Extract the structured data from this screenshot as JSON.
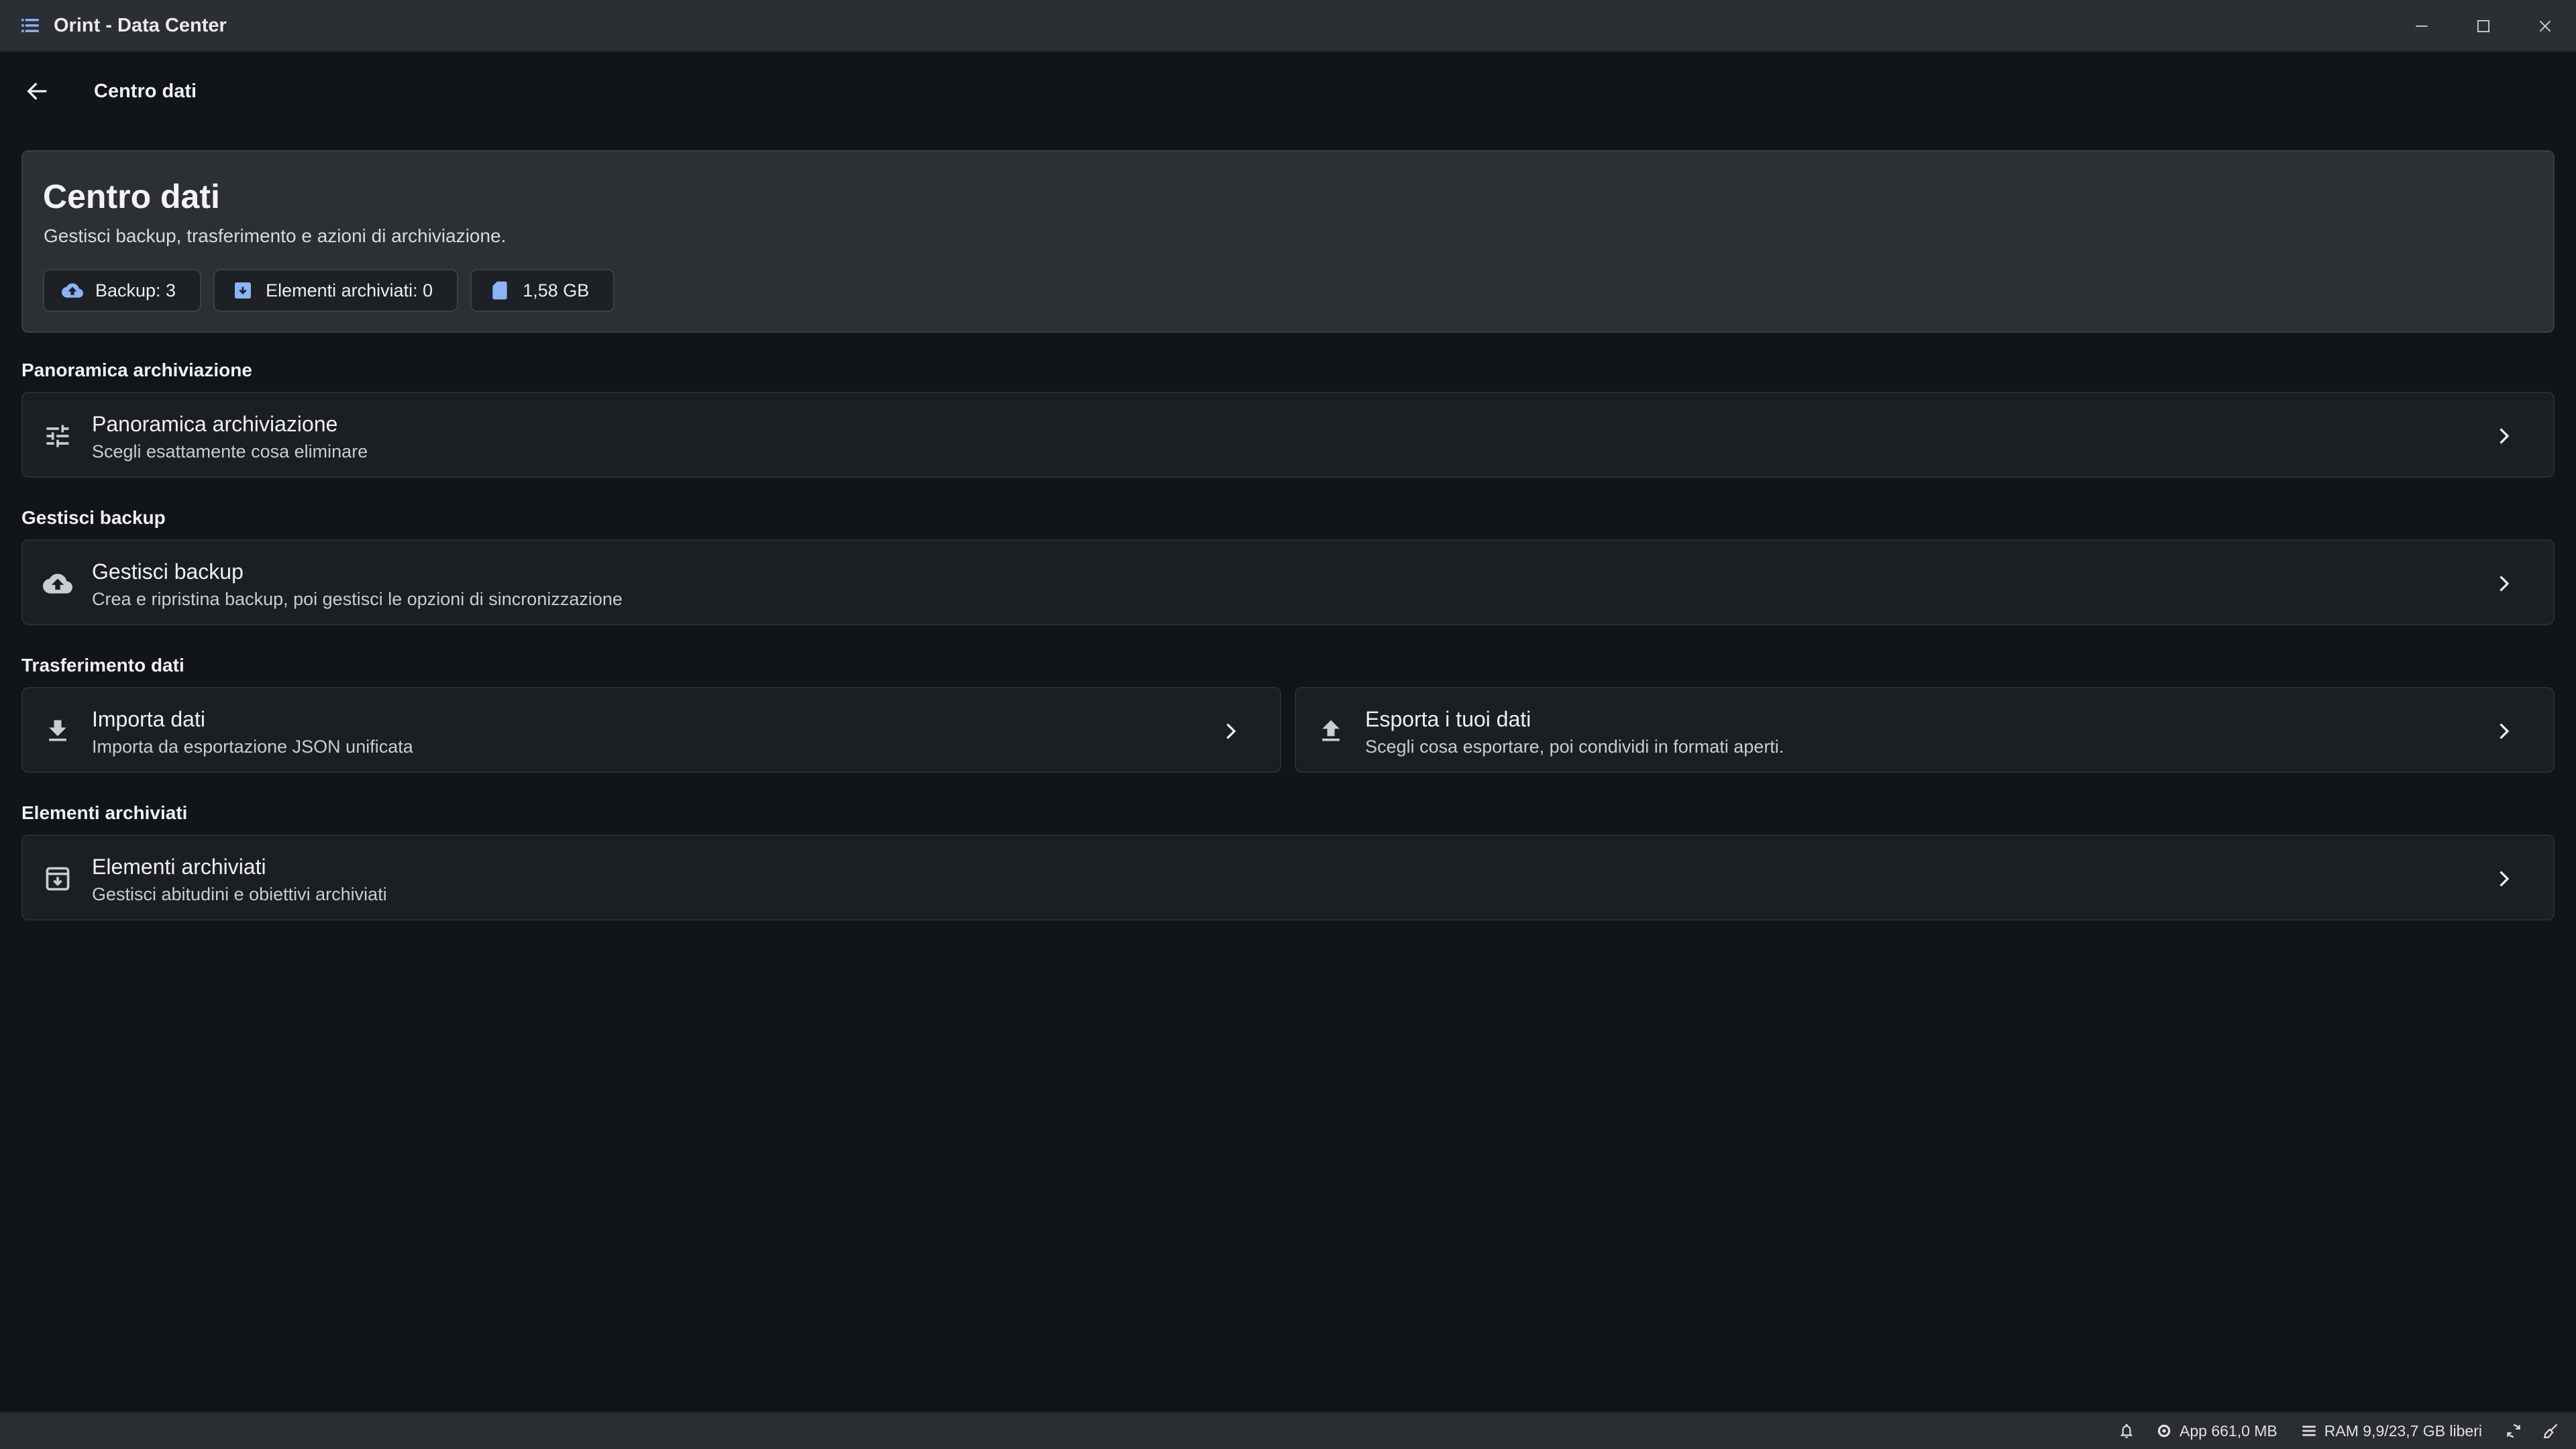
{
  "window": {
    "title": "Orint - Data Center"
  },
  "nav": {
    "title": "Centro dati"
  },
  "header": {
    "title": "Centro dati",
    "subtitle": "Gestisci backup, trasferimento e azioni di archiviazione.",
    "chips": [
      {
        "icon": "cloud-upload-icon",
        "label": "Backup: 3"
      },
      {
        "icon": "archive-icon",
        "label": "Elementi archiviati: 0"
      },
      {
        "icon": "sd-card-icon",
        "label": "1,58 GB"
      }
    ]
  },
  "sections": {
    "storage": {
      "label": "Panoramica archiviazione",
      "card": {
        "icon": "tune-icon",
        "title": "Panoramica archiviazione",
        "subtitle": "Scegli esattamente cosa eliminare"
      }
    },
    "backup": {
      "label": "Gestisci backup",
      "card": {
        "icon": "cloud-upload-icon",
        "title": "Gestisci backup",
        "subtitle": "Crea e ripristina backup, poi gestisci le opzioni di sincronizzazione"
      }
    },
    "transfer": {
      "label": "Trasferimento dati",
      "import": {
        "icon": "download-icon",
        "title": "Importa dati",
        "subtitle": "Importa da esportazione JSON unificata"
      },
      "export": {
        "icon": "upload-icon",
        "title": "Esporta i tuoi dati",
        "subtitle": "Scegli cosa esportare, poi condividi in formati aperti."
      }
    },
    "archived": {
      "label": "Elementi archiviati",
      "card": {
        "icon": "archive-icon",
        "title": "Elementi archiviati",
        "subtitle": "Gestisci abitudini e obiettivi archiviati"
      }
    }
  },
  "statusbar": {
    "app_memory": "App 661,0 MB",
    "ram": "RAM 9,9/23,7 GB liberi"
  },
  "colors": {
    "background": "#111419",
    "card": "#1b1e23",
    "header_card": "#2c2f34",
    "accent": "#8ab4f8"
  }
}
